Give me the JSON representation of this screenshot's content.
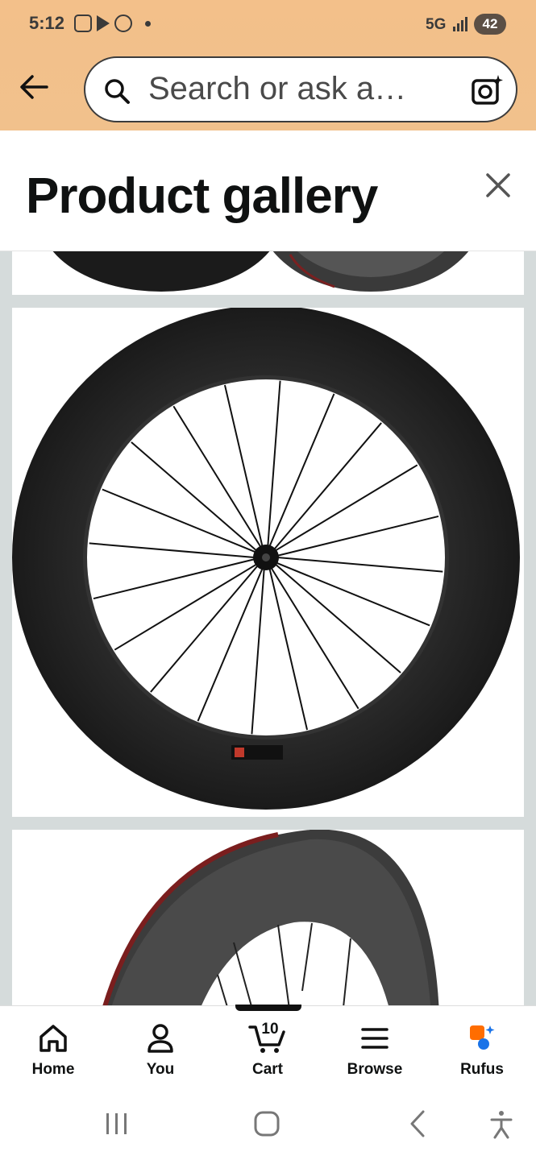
{
  "status_bar": {
    "time": "5:12",
    "network": "5G",
    "battery": "42"
  },
  "search": {
    "placeholder": "Search or ask a…"
  },
  "header": {
    "title": "Product gallery"
  },
  "bottom_nav": {
    "items": [
      {
        "label": "Home"
      },
      {
        "label": "You"
      },
      {
        "label": "Cart",
        "count": "10"
      },
      {
        "label": "Browse"
      },
      {
        "label": "Rufus"
      }
    ]
  },
  "colors": {
    "header_bg": "#f2c28a",
    "gallery_bg": "#d5dbdb",
    "rufus_orange": "#ff6d00",
    "rufus_blue": "#1a73e8"
  }
}
